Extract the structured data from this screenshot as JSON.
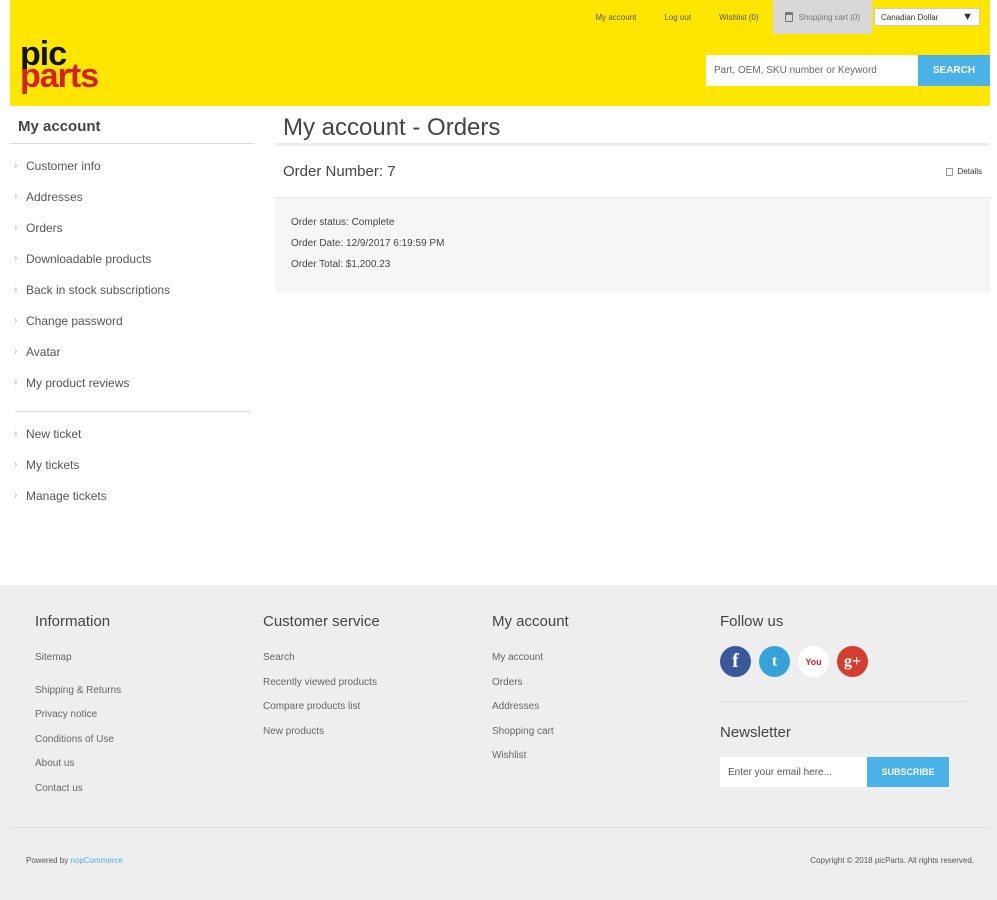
{
  "header": {
    "links": {
      "my_account": "My account",
      "logout": "Log out",
      "wishlist": "Wishlist (0)",
      "cart": "Shopping cart (0)"
    },
    "currency": "Canadian Dollar",
    "logo": {
      "line1": "pic",
      "line2": "parts"
    },
    "search": {
      "placeholder": "Part, OEM, SKU number or Keyword",
      "button": "SEARCH"
    },
    "colors": {
      "background": "#ffe600",
      "accent": "#4ab2e7",
      "logo_red": "#d4202a"
    }
  },
  "sidebar": {
    "title": "My account",
    "items": [
      "Customer info",
      "Addresses",
      "Orders",
      "Downloadable products",
      "Back in stock subscriptions",
      "Change password",
      "Avatar",
      "My product reviews"
    ],
    "tickets": [
      "New ticket",
      "My tickets",
      "Manage tickets"
    ]
  },
  "main": {
    "title": "My account - Orders",
    "order": {
      "number": "Order Number: 7",
      "details": "Details",
      "status": "Order status: Complete",
      "date": "Order Date: 12/9/2017 6:19:59 PM",
      "total": "Order Total: $1,200.23"
    }
  },
  "footer": {
    "information": {
      "title": "Information",
      "links": [
        "Sitemap",
        "Shipping & Returns",
        "Privacy notice",
        "Conditions of Use",
        "About us",
        "Contact us"
      ]
    },
    "customer_service": {
      "title": "Customer service",
      "links": [
        "Search",
        "Recently viewed products",
        "Compare products list",
        "New products"
      ]
    },
    "my_account": {
      "title": "My account",
      "links": [
        "My account",
        "Orders",
        "Addresses",
        "Shopping cart",
        "Wishlist"
      ]
    },
    "follow": {
      "title": "Follow us",
      "icons": [
        "facebook-icon",
        "twitter-icon",
        "youtube-icon",
        "google-plus-icon"
      ],
      "glyphs": {
        "facebook": "f",
        "twitter": "t",
        "youtube": "You",
        "google_plus": "g+"
      }
    },
    "newsletter": {
      "title": "Newsletter",
      "placeholder": "Enter your email here...",
      "button": "SUBSCRIBE"
    },
    "powered_prefix": "Powered by",
    "powered_link": "nopCommerce",
    "copyright": "Copyright © 2018 picParts. All rights reserved."
  }
}
